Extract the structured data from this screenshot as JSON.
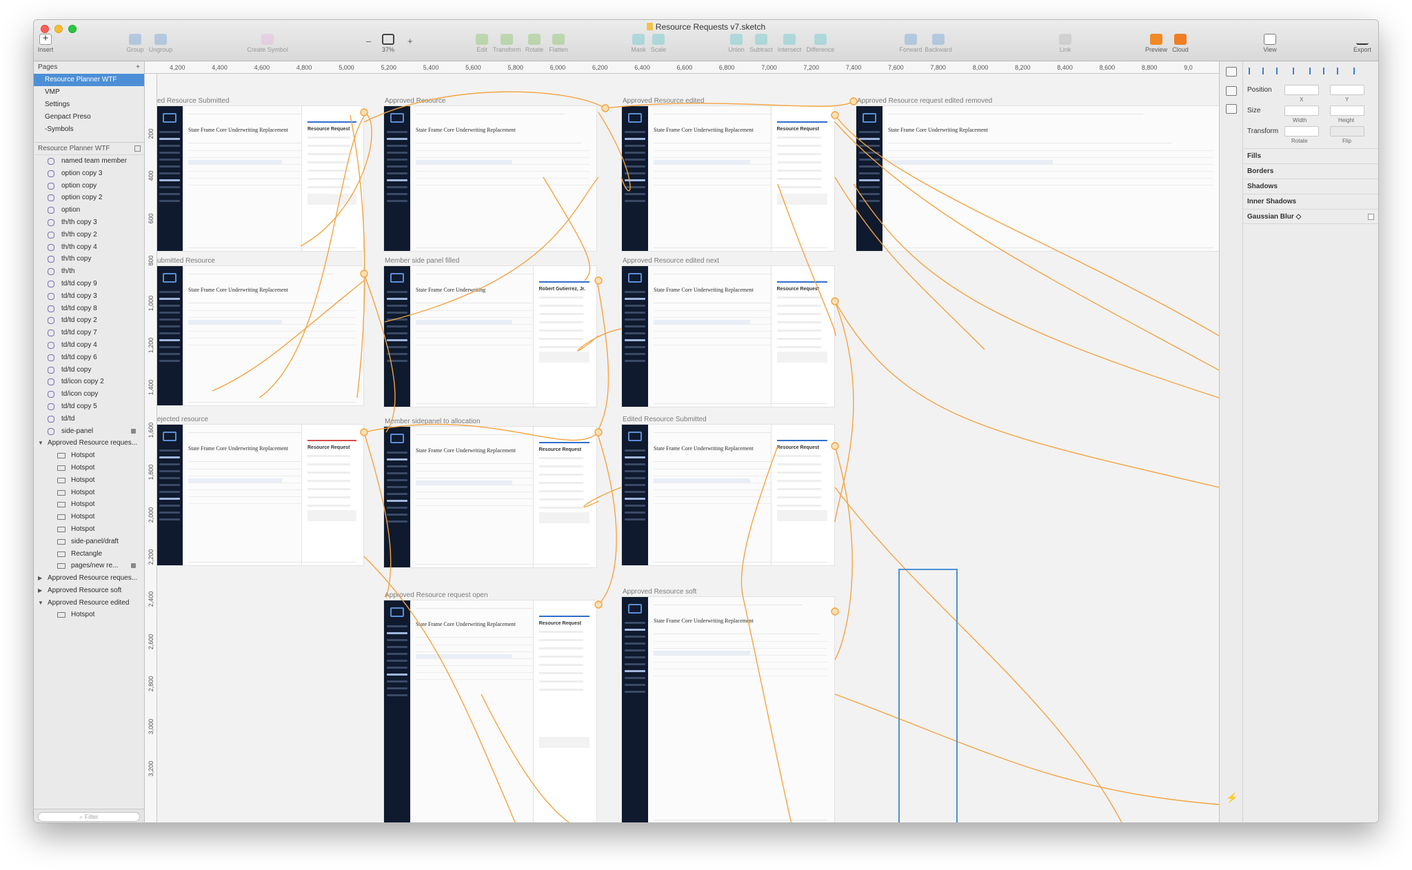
{
  "window": {
    "title": "Resource Requests v7.sketch"
  },
  "toolbar": {
    "insert": "Insert",
    "group": "Group",
    "ungroup": "Ungroup",
    "create_symbol": "Create Symbol",
    "zoom_minus": "–",
    "zoom_plus": "+",
    "zoom_value": "37%",
    "edit": "Edit",
    "transform": "Transform",
    "rotate": "Rotate",
    "flatten": "Flatten",
    "mask": "Mask",
    "scale": "Scale",
    "union": "Union",
    "subtract": "Subtract",
    "intersect": "Intersect",
    "difference": "Difference",
    "forward": "Forward",
    "backward": "Backward",
    "link": "Link",
    "preview": "Preview",
    "cloud": "Cloud",
    "view": "View",
    "export": "Export"
  },
  "pages": {
    "header": "Pages",
    "items": [
      "Resource Planner WTF",
      "VMP",
      "Settings",
      "Genpact Preso",
      "-Symbols"
    ],
    "selected": "Resource Planner WTF"
  },
  "layers": {
    "header": "Resource Planner WTF",
    "symbols": [
      "named team member",
      "option copy 3",
      "option copy",
      "option copy 2",
      "option",
      "th/th copy 3",
      "th/th copy 2",
      "th/th copy 4",
      "th/th copy",
      "th/th",
      "td/td copy 9",
      "td/td copy 3",
      "td/td copy 8",
      "td/td copy 2",
      "td/td copy 7",
      "td/td copy 4",
      "td/td copy 6",
      "td/td copy",
      "td/icon copy 2",
      "td/icon copy",
      "td/td copy 5",
      "td/td",
      "side-panel"
    ],
    "group1": "Approved Resource reques...",
    "group1_children": [
      "Hotspot",
      "Hotspot",
      "Hotspot",
      "Hotspot",
      "Hotspot",
      "Hotspot",
      "Hotspot",
      "side-panel/draft",
      "Rectangle",
      "pages/new re..."
    ],
    "group2": "Approved Resource reques...",
    "group3": "Approved Resource soft",
    "group4": "Approved Resource edited",
    "group4_children": [
      "Hotspot"
    ],
    "filter_placeholder": "Filter"
  },
  "rulers": {
    "h": [
      "4,200",
      "4,400",
      "4,600",
      "4,800",
      "5,000",
      "5,200",
      "5,400",
      "5,600",
      "5,800",
      "6,000",
      "6,200",
      "6,400",
      "6,600",
      "6,800",
      "7,000",
      "7,200",
      "7,400",
      "7,600",
      "7,800",
      "8,000",
      "8,200",
      "8,400",
      "8,600",
      "8,800",
      "9,0"
    ],
    "v": [
      "200",
      "400",
      "600",
      "800",
      "1,000",
      "1,200",
      "1,400",
      "1,600",
      "1,800",
      "2,000",
      "2,200",
      "2,400",
      "2,600",
      "2,800",
      "3,000",
      "3,200"
    ]
  },
  "artboards": [
    {
      "title": "ed Resource Submitted",
      "heading": "State Frame Core Underwriting Replacement",
      "panel": "Resource Request"
    },
    {
      "title": "Approved Resource",
      "heading": "State Frame Core Underwriting Replacement",
      "panel": ""
    },
    {
      "title": "Approved Resource edited",
      "heading": "State Frame Core Underwriting Replacement",
      "panel": "Resource Request"
    },
    {
      "title": "Approved Resource request edited removed",
      "heading": "State Frame Core Underwriting Replacement",
      "panel": ""
    },
    {
      "title": "ubmitted Resource",
      "heading": "State Frame Core Underwriting Replacement",
      "panel": ""
    },
    {
      "title": "Member side panel filled",
      "heading": "State Frame Core Underwriting",
      "panel": "Robert Gutierrez, Jr."
    },
    {
      "title": "Approved Resource edited next",
      "heading": "State Frame Core Underwriting Replacement",
      "panel": "Resource Request"
    },
    {
      "title": "ejected resource",
      "heading": "State Frame Core Underwriting Replacement",
      "panel": "Resource Request"
    },
    {
      "title": "Member sidepanel to allocation",
      "heading": "State Frame Core Underwriting Replacement",
      "panel": "Resource Request"
    },
    {
      "title": "Edited Resource Submitted",
      "heading": "State Frame Core Underwriting Replacement",
      "panel": "Resource Request"
    },
    {
      "title": "Approved Resource request open",
      "heading": "State Frame Core Underwriting Replacement",
      "panel": "Resource Request"
    },
    {
      "title": "Approved Resource soft",
      "heading": "State Frame Core Underwriting Replacement",
      "panel": ""
    }
  ],
  "inspector": {
    "position": "Position",
    "x": "X",
    "y": "Y",
    "size": "Size",
    "width": "Width",
    "height": "Height",
    "transform": "Transform",
    "rotate": "Rotate",
    "flip": "Flip",
    "fills": "Fills",
    "borders": "Borders",
    "shadows": "Shadows",
    "inner_shadows": "Inner Shadows",
    "gaussian_blur": "Gaussian Blur ◇"
  },
  "colors": {
    "selection": "#4c8fd6",
    "link": "#f4a340",
    "nav": "#0f1a2e"
  }
}
